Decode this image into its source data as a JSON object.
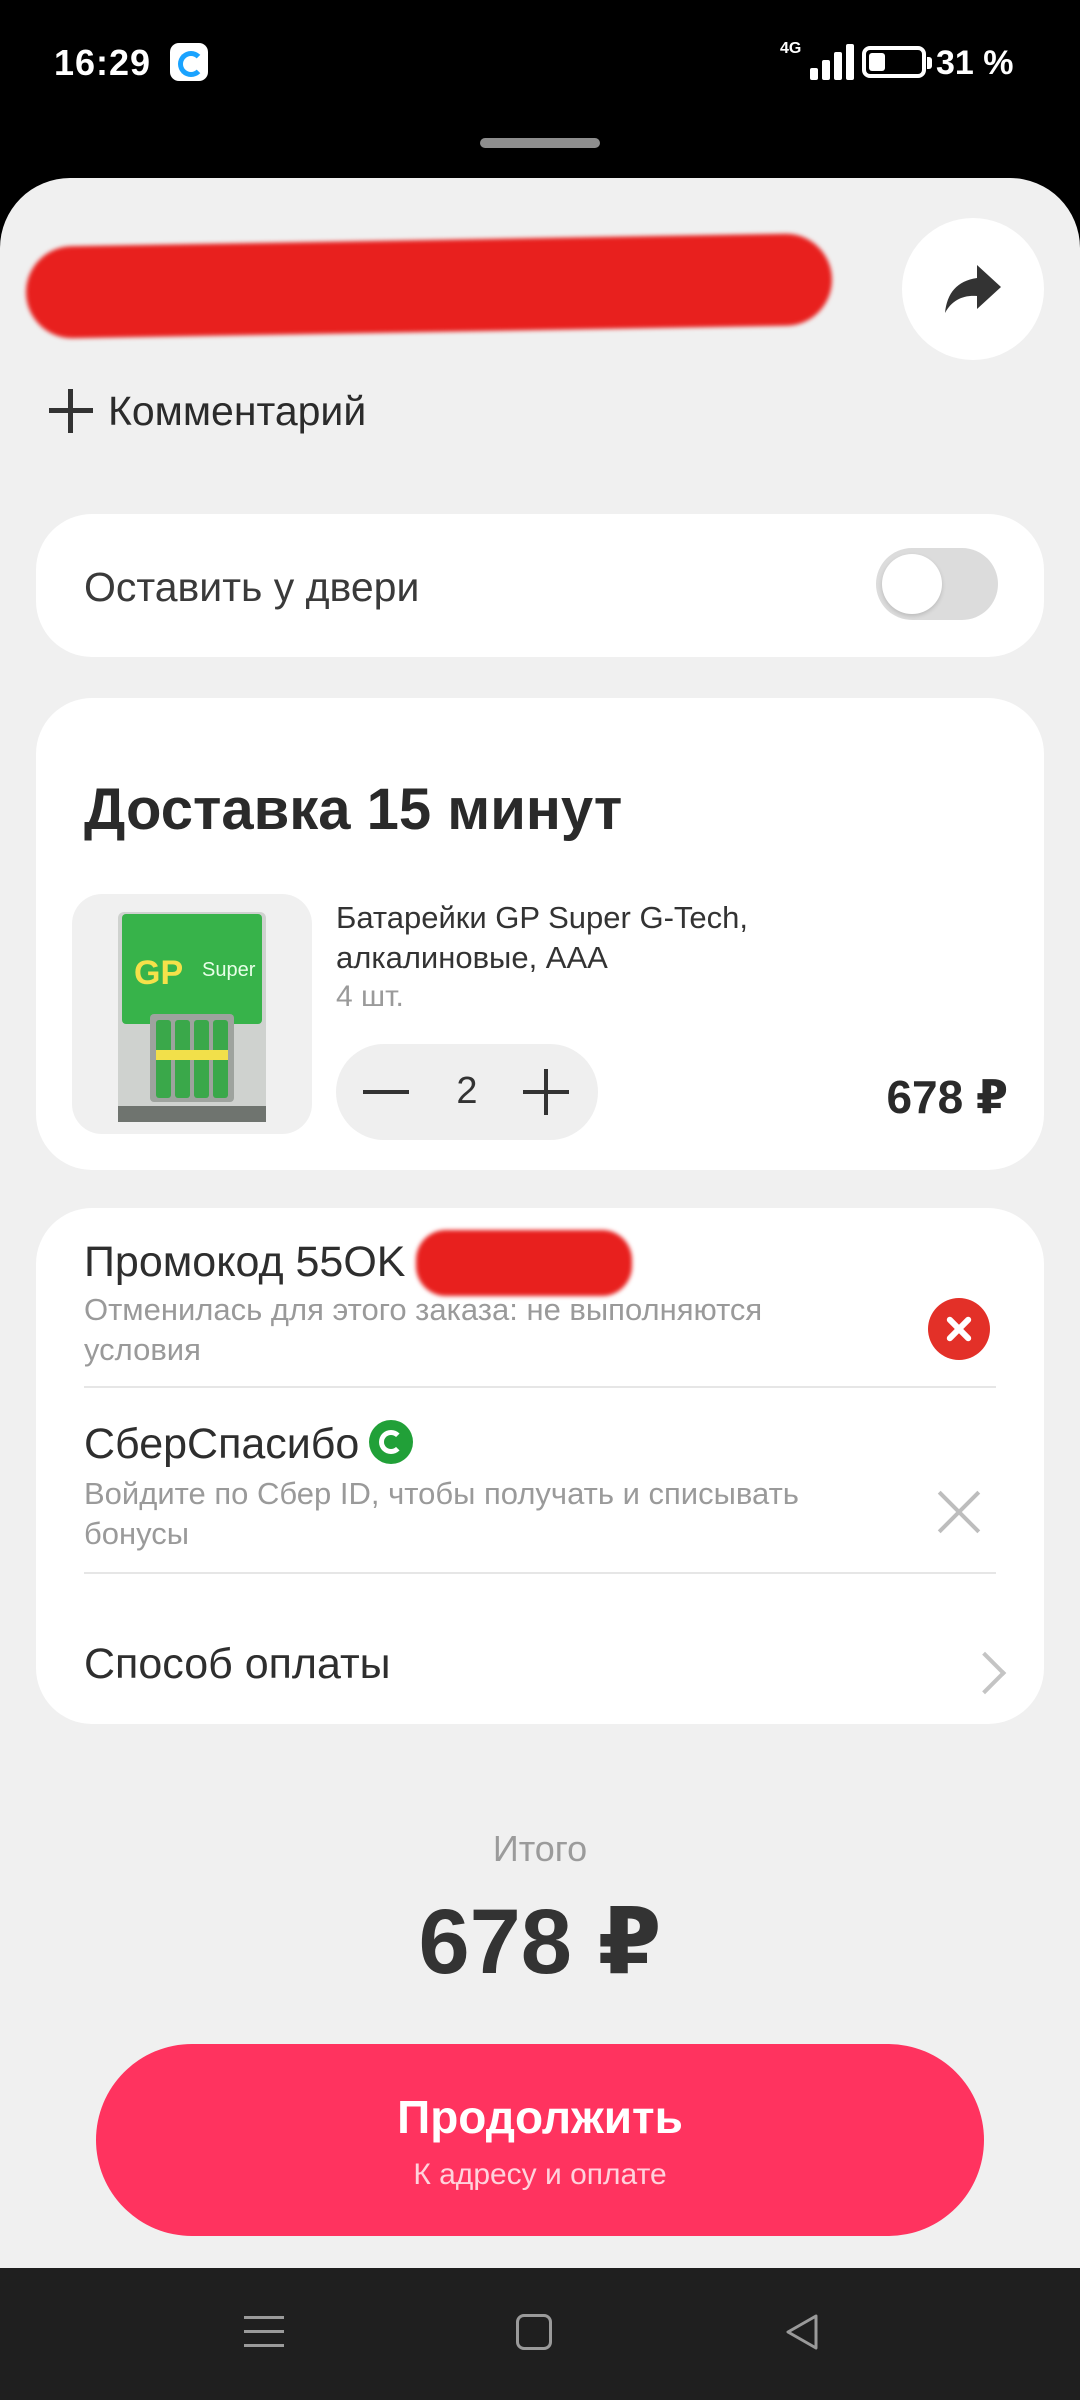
{
  "status_bar": {
    "time": "16:29",
    "network": "4G",
    "battery": "31 %",
    "battery_level": 0.31,
    "icons": [
      "app-notification-icon",
      "signal-icon",
      "battery-icon"
    ]
  },
  "header": {
    "share_icon": "share-arrow-icon"
  },
  "comment": {
    "label": "Комментарий",
    "icon": "plus-icon"
  },
  "leave_at_door": {
    "label": "Оставить у двери",
    "enabled": false
  },
  "delivery": {
    "title": "Доставка 15 минут",
    "item": {
      "name": "Батарейки GP Super G-Tech, алкалиновые, AAA",
      "pack": "4 шт.",
      "quantity": "2",
      "price": "678 ₽",
      "image_brand": "GP",
      "image_text": "Super"
    }
  },
  "promo": {
    "title": "Промокод 55OK",
    "subtitle": "Отменилась для этого заказа: не выполняются условия",
    "icon": "error-icon"
  },
  "sber": {
    "title": "СберСпасибо",
    "subtitle": "Войдите по Сбер ID, чтобы получать и списывать бонусы",
    "icon": "close-icon"
  },
  "payment": {
    "label": "Способ оплаты",
    "icon": "chevron-right-icon"
  },
  "total": {
    "label": "Итого",
    "value": "678 ₽"
  },
  "continue": {
    "label": "Продолжить",
    "sublabel": "К адресу и оплате"
  },
  "colors": {
    "accent": "#ff335f",
    "error": "#e33028",
    "sber": "#21a038",
    "sheet_bg": "#f0f0f0"
  }
}
